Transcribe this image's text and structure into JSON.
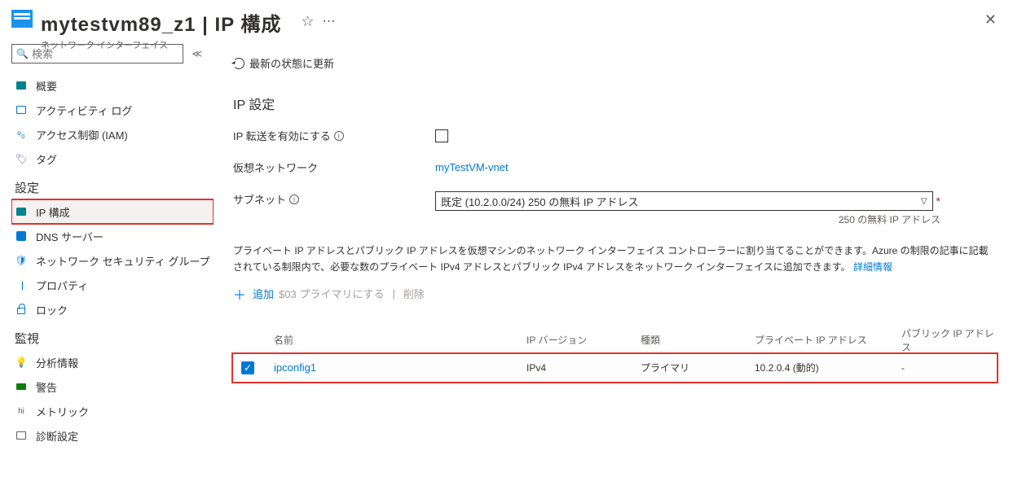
{
  "header": {
    "title": "mytestvm89_z1 | IP 構成",
    "subtitle": "ネットワーク インターフェイス"
  },
  "sidebar": {
    "search_placeholder": "検索",
    "items": {
      "overview": "概要",
      "activity": "アクティビティ ログ",
      "iam": "アクセス制御 (IAM)",
      "tags": "タグ"
    },
    "group_settings": "設定",
    "settings": {
      "ipconfig": "IP 構成",
      "dns": "DNS サーバー",
      "nsg": "ネットワーク セキュリティ グループ",
      "props": "プロパティ",
      "lock": "ロック"
    },
    "group_monitor": "監視",
    "monitor": {
      "insights": "分析情報",
      "alerts": "警告",
      "metrics": "メトリック",
      "diag": "診断設定"
    }
  },
  "main": {
    "refresh": "最新の状態に更新",
    "section_title": "IP 設定",
    "forward_label": "IP 転送を有効にする",
    "vnet_label": "仮想ネットワーク",
    "vnet_value": "myTestVM-vnet",
    "subnet_label": "サブネット",
    "subnet_value": "既定 (10.2.0.0/24)  250 の無料 IP アドレス",
    "subnet_help": "250 の無料 IP アドレス",
    "para": "プライベート IP アドレスとパブリック IP アドレスを仮想マシンのネットワーク インターフェイス コントローラーに割り当てることができます。Azure の制限の記事に記載されている制限内で、必要な数のプライベート IPv4 アドレスとパブリック IPv4 アドレスをネットワーク インターフェイスに追加できます。",
    "para_link": "詳細情報",
    "add": "追加",
    "primary": "$03 プライマリにする",
    "delete": "削除",
    "th": {
      "name": "名前",
      "ver": "IP バージョン",
      "kind": "種類",
      "priv": "プライベート IP アドレス",
      "pub": "パブリック IP アドレス"
    },
    "row": {
      "name": "ipconfig1",
      "ver": "IPv4",
      "kind": "プライマリ",
      "priv": "10.2.0.4  (動的)",
      "pub": "-"
    }
  }
}
